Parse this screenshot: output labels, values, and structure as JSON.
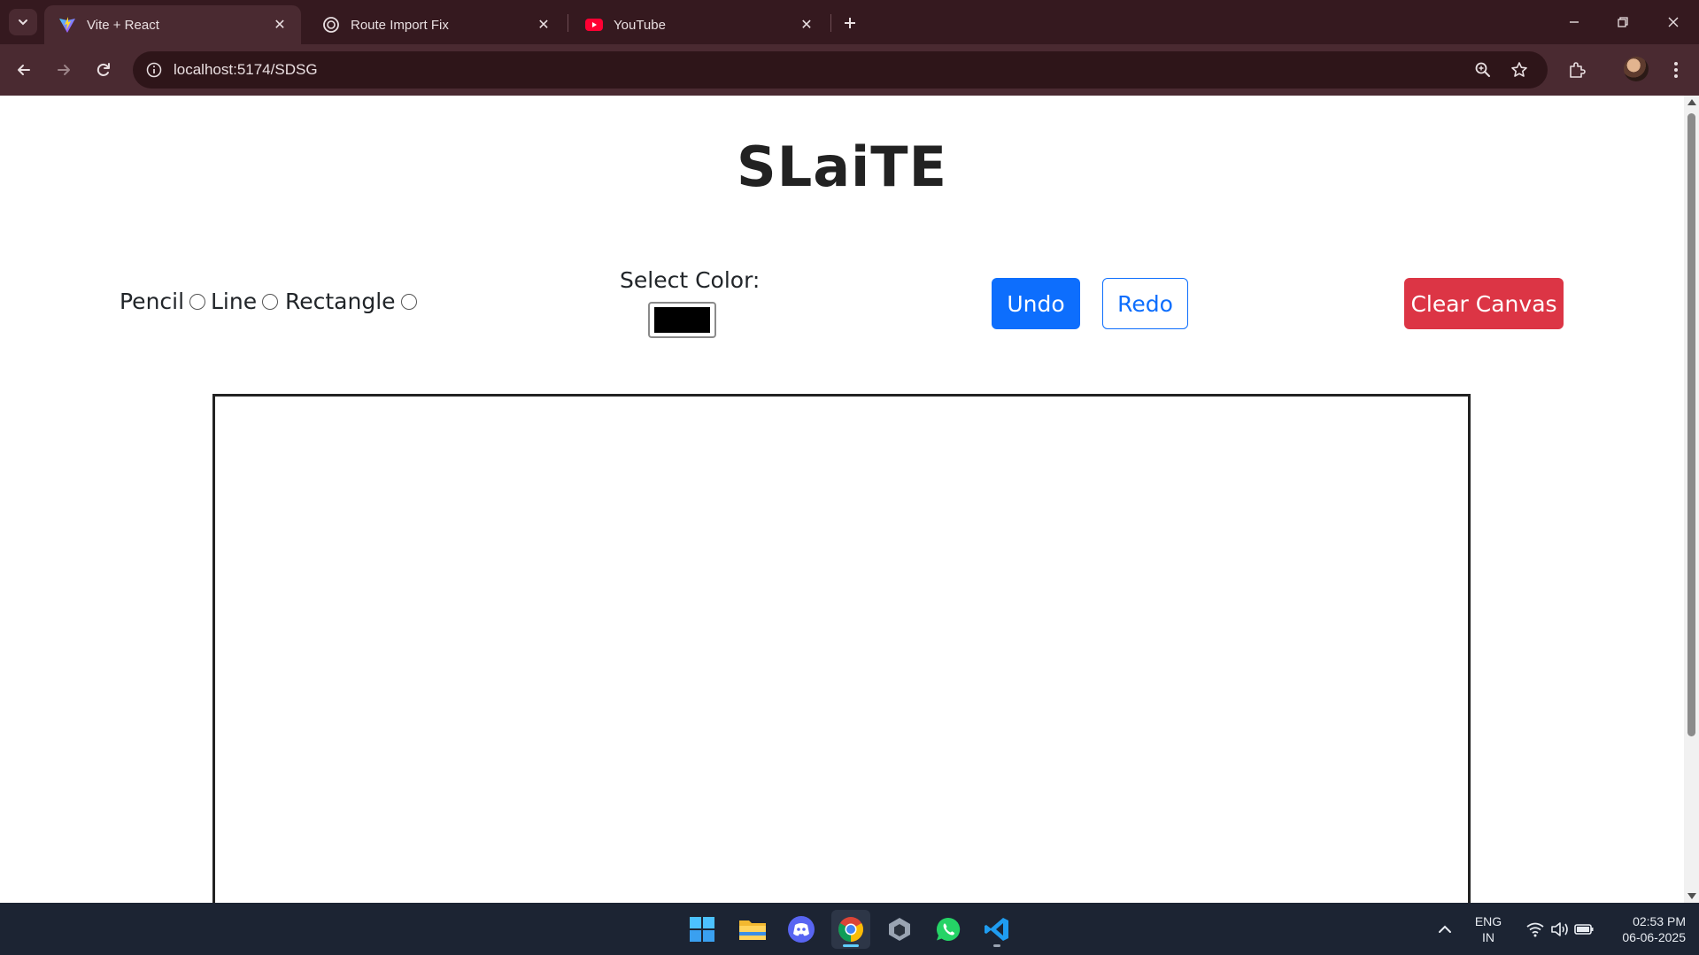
{
  "browser": {
    "tabs": [
      {
        "title": "Vite + React",
        "active": true
      },
      {
        "title": "Route Import Fix",
        "active": false
      },
      {
        "title": "YouTube",
        "active": false
      }
    ],
    "url": "localhost:5174/SDSG"
  },
  "app": {
    "title": "SLaiTE",
    "tools": [
      {
        "label": "Pencil",
        "selected": false
      },
      {
        "label": "Line",
        "selected": false
      },
      {
        "label": "Rectangle",
        "selected": false
      }
    ],
    "color_label": "Select Color:",
    "selected_color": "#000000",
    "undo_label": "Undo",
    "redo_label": "Redo",
    "clear_label": "Clear Canvas"
  },
  "taskbar": {
    "apps": [
      "windows-start",
      "file-explorer",
      "discord",
      "chrome",
      "unity",
      "whatsapp",
      "vscode"
    ],
    "lang_primary": "ENG",
    "lang_secondary": "IN",
    "time": "02:53 PM",
    "date": "06-06-2025"
  },
  "colors": {
    "primary": "#0d6efd",
    "danger": "#dc3545",
    "chrome_bg": "#35191f"
  }
}
